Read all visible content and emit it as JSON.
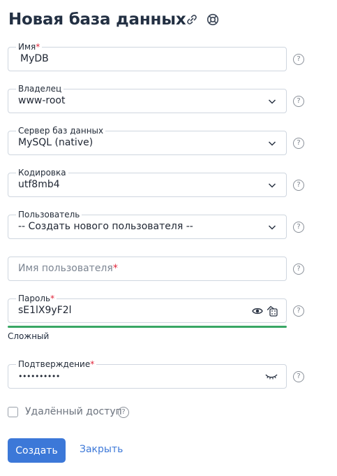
{
  "page": {
    "title": "Новая база данных",
    "link_icon": "link-icon",
    "lifebuoy_icon": "lifebuoy-icon"
  },
  "fields": {
    "name": {
      "label": "Имя",
      "required_mark": "*",
      "value": "MyDB"
    },
    "owner": {
      "label": "Владелец",
      "value": "www-root"
    },
    "server": {
      "label": "Сервер баз данных",
      "value": "MySQL (native)"
    },
    "charset": {
      "label": "Кодировка",
      "value": "utf8mb4"
    },
    "user": {
      "label": "Пользователь",
      "value": "-- Создать нового пользователя --"
    },
    "username": {
      "placeholder": "Имя пользователя",
      "required_mark": "*"
    },
    "password": {
      "label": "Пароль",
      "required_mark": "*",
      "value": "sE1lX9yF2l",
      "strength": "Сложный",
      "strength_color": "#3aa765"
    },
    "confirm": {
      "label": "Подтверждение",
      "required_mark": "*",
      "value": "••••••••••"
    }
  },
  "remote_access": {
    "label": "Удалённый доступ",
    "checked": false
  },
  "help_glyph": "?",
  "actions": {
    "create": "Создать",
    "close": "Закрыть"
  },
  "colors": {
    "accent": "#3c78d8",
    "required": "#e02439",
    "strength": "#3aa765"
  }
}
